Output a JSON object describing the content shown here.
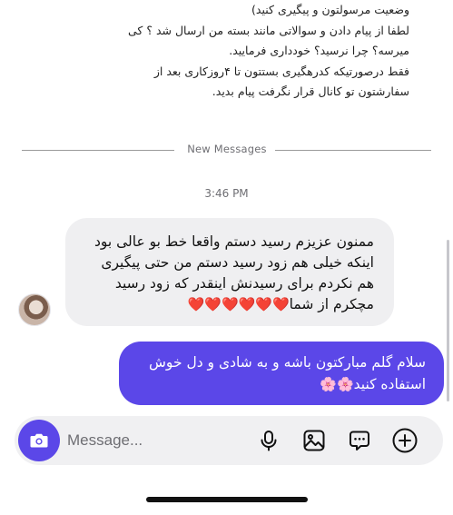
{
  "previous_message": {
    "lines": [
      "وضعیت مرسولتون و پیگیری کنید)",
      "لطفا از پیام دادن و سوالاتی مانند بسته من ارسال شد ؟ کی",
      "میرسه؟ چرا نرسید؟ خودداری فرمایید.",
      "فقط درصورتیکه کدرهگیری بستتون تا ۴روزکاری بعد از",
      "سفارشتون تو کانال قرار نگرفت پیام بدید."
    ]
  },
  "divider": {
    "label": "New Messages"
  },
  "timestamp": "3:46 PM",
  "incoming_message": {
    "lines": [
      "ممنون عزیزم رسید دستم واقعا خط بو عالی بود",
      "اینکه خیلی هم زود رسید دستم من حتی پیگیری",
      "هم نکردم برای رسیدنش اینقدر که زود رسید"
    ],
    "last_line_text": "مچکرم از شما",
    "emoji": "❤️❤️❤️❤️❤️❤️"
  },
  "outgoing_message": {
    "line1": "سلام گلم مبارکتون باشه و به شادی و دل خوش",
    "line2_text": "استفاده کنید",
    "emoji": "🌸🌸"
  },
  "composer": {
    "placeholder": "Message...",
    "value": "",
    "icons": [
      "camera-icon",
      "microphone-icon",
      "gallery-icon",
      "sticker-icon",
      "plus-icon"
    ]
  },
  "colors": {
    "accent": "#5b47e8",
    "incoming_bubble": "#efeff1",
    "composer_bg": "#f0f0f2",
    "muted_text": "#6e6e73"
  }
}
